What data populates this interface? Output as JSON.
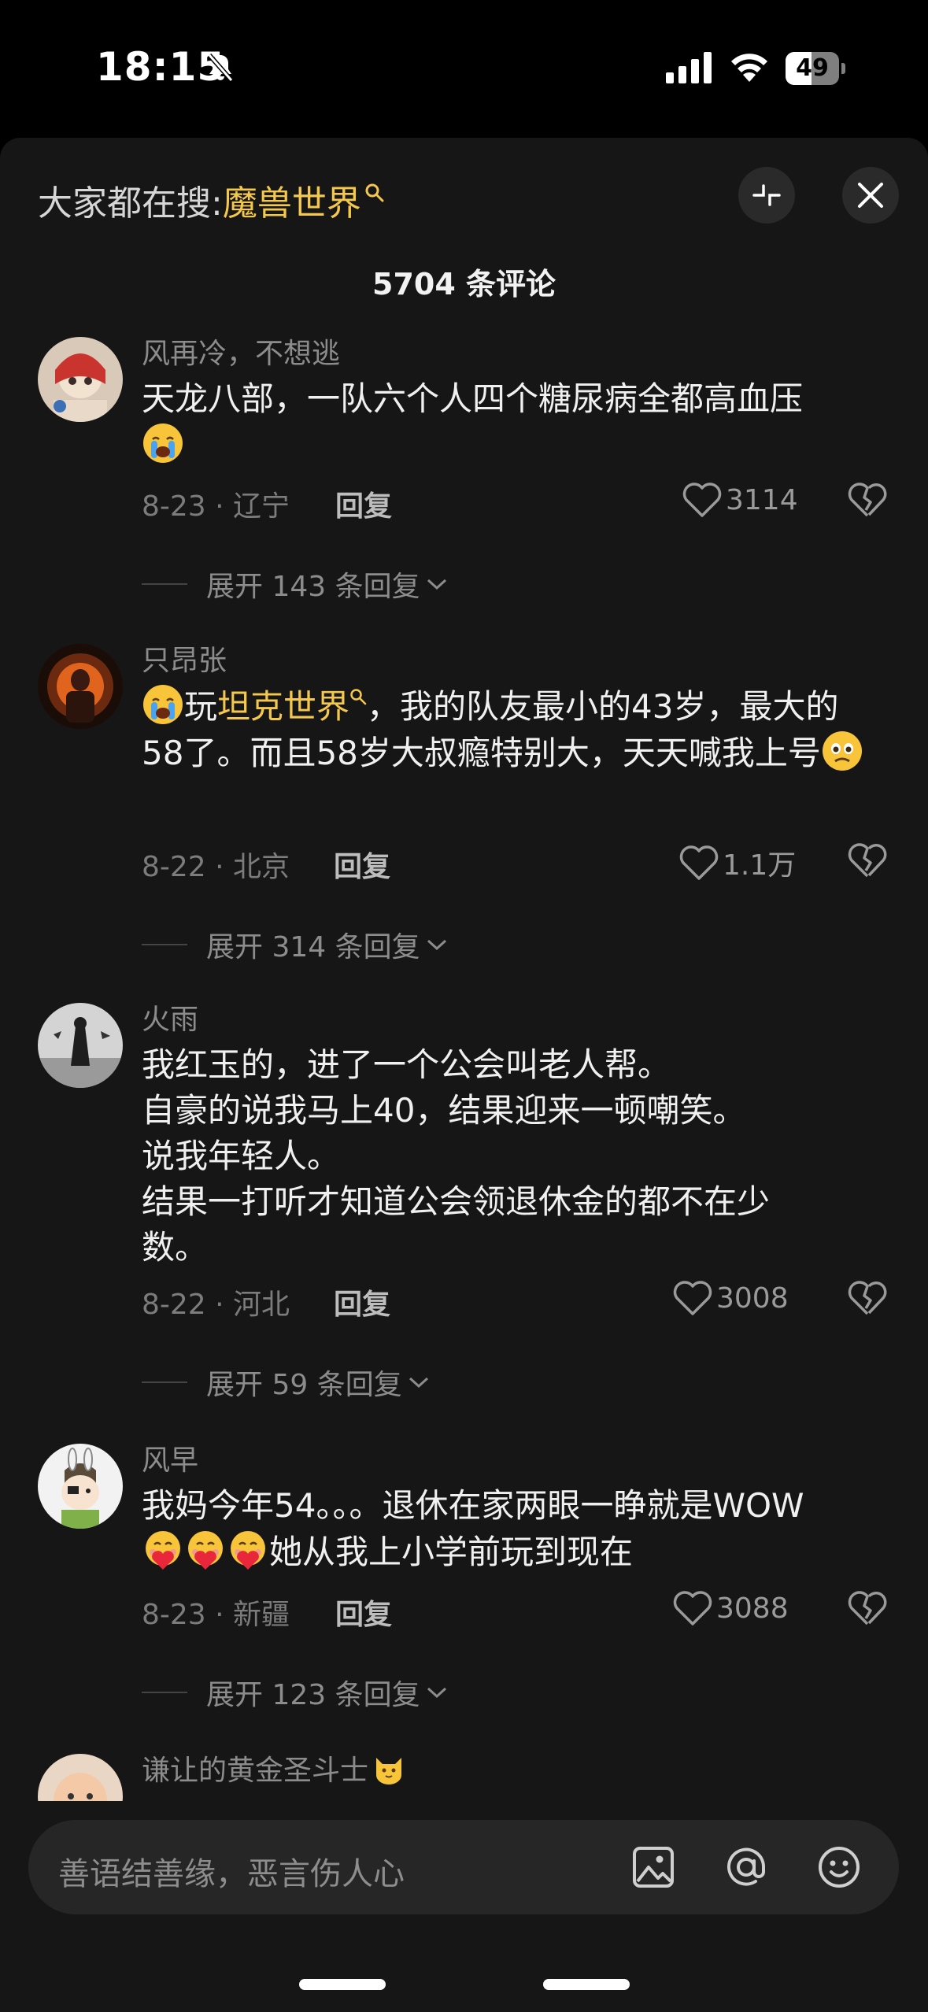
{
  "status_bar": {
    "time": "18:15",
    "battery": "49",
    "battery_level": 0.49
  },
  "header": {
    "search_prefix": "大家都在搜:",
    "search_keyword": "魔兽世界",
    "comment_count": "5704 条评论"
  },
  "comments": [
    {
      "username": "风再冷，不想逃",
      "text": "天龙八部，一队六个人四个糖尿病全都高血压",
      "emoji": [
        "crying-face"
      ],
      "date_location": "8-23 · 辽宁",
      "reply_label": "回复",
      "likes": "3114",
      "expand_label": "展开 143 条回复"
    },
    {
      "username": "只昂张",
      "text_prefix": "玩",
      "text_link": "坦克世界",
      "text_rest": "，我的队友最小的43岁，最大的58了。而且58岁大叔瘾特别大，天天喊我上号",
      "emoji": [
        "crying-face",
        "holding-back-tears-face"
      ],
      "date_location": "8-22 · 北京",
      "reply_label": "回复",
      "likes": "1.1万",
      "expand_label": "展开 314 条回复"
    },
    {
      "username": "火雨",
      "lines": [
        "我红玉的，进了一个公会叫老人帮。",
        "自豪的说我马上40，结果迎来一顿嘲笑。",
        "说我年轻人。",
        "结果一打听才知道公会领退休金的都不在少",
        "数。"
      ],
      "date_location": "8-22 · 河北",
      "reply_label": "回复",
      "likes": "3008",
      "expand_label": "展开 59 条回复"
    },
    {
      "username": "风早",
      "text_line1": "我妈今年54。。。退休在家两眼一睁就是WOW",
      "text_line2": "她从我上小学前玩到现在",
      "emoji": [
        "heart-hug-face",
        "heart-hug-face",
        "heart-hug-face"
      ],
      "date_location": "8-23 · 新疆",
      "reply_label": "回复",
      "likes": "3088",
      "expand_label": "展开 123 条回复"
    },
    {
      "username": "谦让的黄金圣斗士",
      "emoji": [
        "cat-face"
      ]
    }
  ],
  "input": {
    "placeholder": "善语结善缘，恶言伤人心"
  },
  "colors": {
    "background": "#161616",
    "accent": "#f3c84c",
    "text": "#f0f0f0",
    "muted": "#8c8c8c"
  }
}
